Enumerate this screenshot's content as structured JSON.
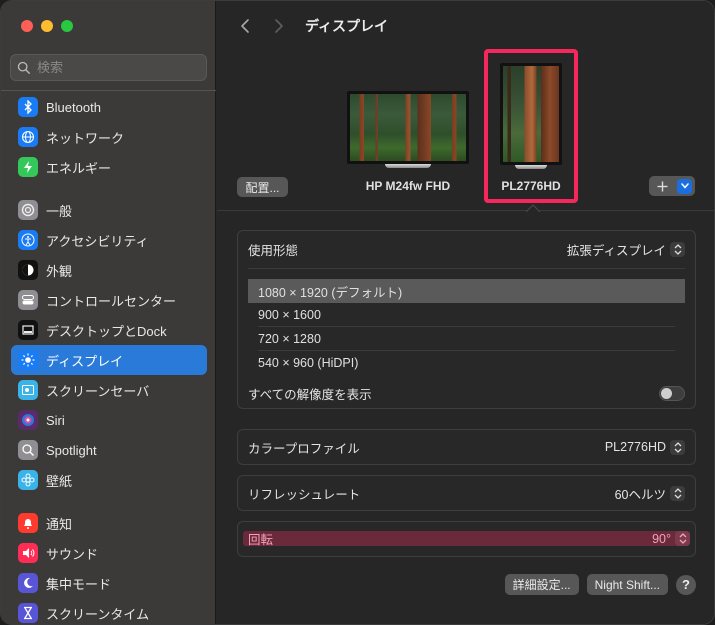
{
  "window": {
    "controls": [
      "close",
      "minimize",
      "zoom"
    ]
  },
  "sidebar": {
    "search": {
      "placeholder": "検索",
      "value": ""
    },
    "items": [
      {
        "label": "Bluetooth",
        "icon": "bluetooth-icon",
        "color": "#1a7cf5",
        "group": 0
      },
      {
        "label": "ネットワーク",
        "icon": "globe-icon",
        "color": "#1a7cf5",
        "group": 0
      },
      {
        "label": "エネルギー",
        "icon": "bolt-icon",
        "color": "#34c759",
        "group": 0
      },
      {
        "label": "一般",
        "icon": "gear-icon",
        "color": "#8e8e93",
        "group": 1
      },
      {
        "label": "アクセシビリティ",
        "icon": "accessibility-icon",
        "color": "#1a7cf5",
        "group": 1
      },
      {
        "label": "外観",
        "icon": "appearance-icon",
        "color": "#111111",
        "group": 1
      },
      {
        "label": "コントロールセンター",
        "icon": "control-center-icon",
        "color": "#8e8e93",
        "group": 1
      },
      {
        "label": "デスクトップとDock",
        "icon": "dock-icon",
        "color": "#111111",
        "group": 1
      },
      {
        "label": "ディスプレイ",
        "icon": "sun-icon",
        "color": "#1a7cf5",
        "group": 1,
        "active": true
      },
      {
        "label": "スクリーンセーバ",
        "icon": "screensaver-icon",
        "color": "#3ab3e8",
        "group": 1
      },
      {
        "label": "Siri",
        "icon": "siri-icon",
        "color": "#5a2a6a",
        "group": 1
      },
      {
        "label": "Spotlight",
        "icon": "magnifier-icon",
        "color": "#8e8e93",
        "group": 1
      },
      {
        "label": "壁紙",
        "icon": "flower-icon",
        "color": "#3ab3e8",
        "group": 1
      },
      {
        "label": "通知",
        "icon": "bell-icon",
        "color": "#ff3b30",
        "group": 2
      },
      {
        "label": "サウンド",
        "icon": "speaker-icon",
        "color": "#ff2d55",
        "group": 2
      },
      {
        "label": "集中モード",
        "icon": "moon-icon",
        "color": "#5856d6",
        "group": 2
      },
      {
        "label": "スクリーンタイム",
        "icon": "hourglass-icon",
        "color": "#5856d6",
        "group": 2
      }
    ]
  },
  "header": {
    "title": "ディスプレイ"
  },
  "displays": {
    "arrange_label": "配置...",
    "monitors": [
      {
        "name": "HP M24fw FHD",
        "orientation": "landscape",
        "selected": false
      },
      {
        "name": "PL2776HD",
        "orientation": "portrait",
        "selected": true
      }
    ],
    "add_label": "+",
    "highlight_color": "#f5275c"
  },
  "settings": {
    "usage": {
      "label": "使用形態",
      "value": "拡張ディスプレイ"
    },
    "resolutions": [
      {
        "label": "1080 × 1920 (デフォルト)",
        "selected": true
      },
      {
        "label": "900 × 1600",
        "selected": false
      },
      {
        "label": "720 × 1280",
        "selected": false
      },
      {
        "label": "540 × 960 (HiDPI)",
        "selected": false
      }
    ],
    "show_all": {
      "label": "すべての解像度を表示",
      "on": false
    },
    "color_profile": {
      "label": "カラープロファイル",
      "value": "PL2776HD"
    },
    "refresh_rate": {
      "label": "リフレッシュレート",
      "value": "60ヘルツ"
    },
    "rotation": {
      "label": "回転",
      "value": "90°"
    }
  },
  "footer": {
    "advanced_label": "詳細設定...",
    "night_shift_label": "Night Shift...",
    "help_label": "?"
  }
}
